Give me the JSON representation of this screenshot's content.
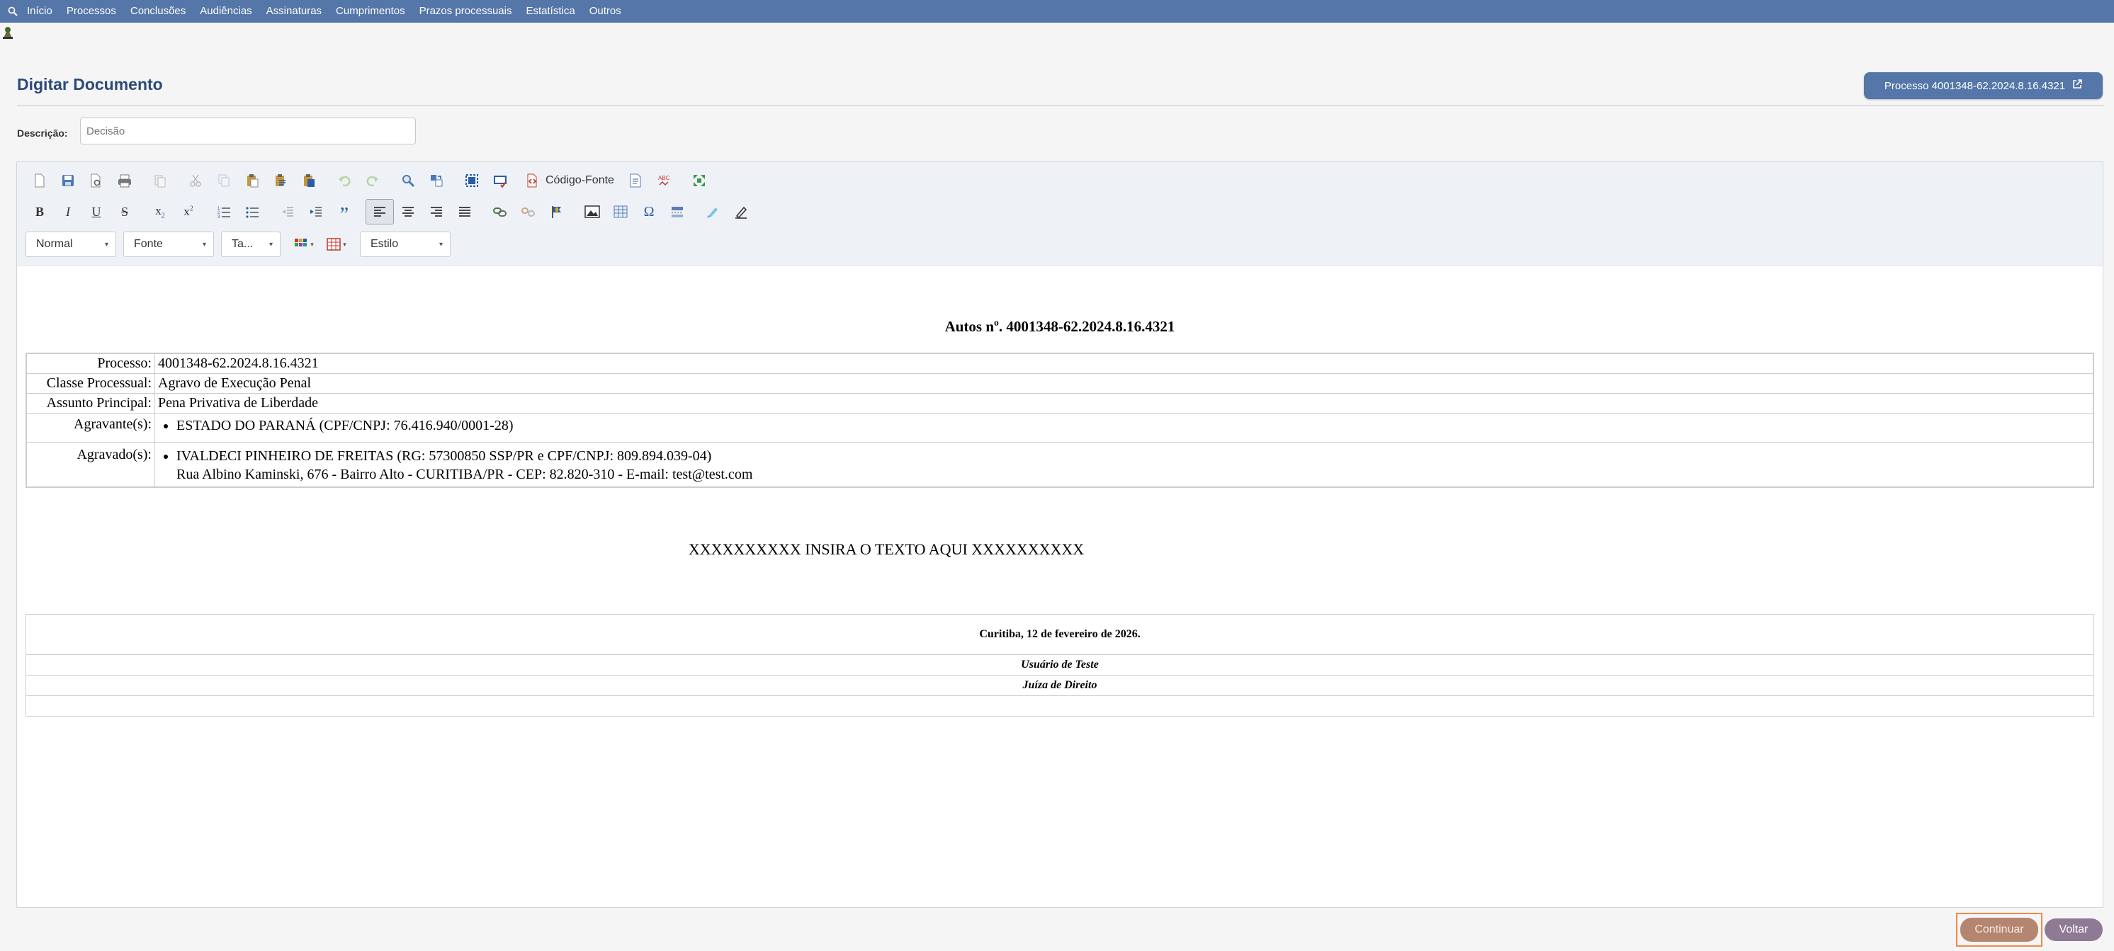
{
  "nav": {
    "items": [
      "Início",
      "Processos",
      "Conclusões",
      "Audiências",
      "Assinaturas",
      "Cumprimentos",
      "Prazos processuais",
      "Estatística",
      "Outros"
    ]
  },
  "page": {
    "title": "Digitar Documento",
    "process_button": "Processo 4001348-62.2024.8.16.4321"
  },
  "description": {
    "label": "Descrição:",
    "placeholder": "Decisão"
  },
  "toolbar": {
    "source_label": "Código-Fonte",
    "format_select": "Normal",
    "font_select": "Fonte",
    "size_select": "Ta...",
    "style_select": "Estilo"
  },
  "document": {
    "heading": "Autos nº. 4001348-62.2024.8.16.4321",
    "rows": [
      {
        "label": "Processo:",
        "value": "4001348-62.2024.8.16.4321"
      },
      {
        "label": "Classe Processual:",
        "value": "Agravo de Execução Penal"
      },
      {
        "label": "Assunto Principal:",
        "value": "Pena Privativa de Liberdade"
      }
    ],
    "agravante_label": "Agravante(s):",
    "agravante": "ESTADO DO PARANÁ (CPF/CNPJ: 76.416.940/0001-28)",
    "agravado_label": "Agravado(s):",
    "agravado": "IVALDECI PINHEIRO DE FREITAS (RG: 57300850 SSP/PR e CPF/CNPJ: 809.894.039-04)",
    "agravado_address": "Rua Albino Kaminski, 676 - Bairro Alto - CURITIBA/PR - CEP: 82.820-310 - E-mail: test@test.com",
    "placeholder_text": "XXXXXXXXXX INSIRA O TEXTO AQUI XXXXXXXXXX",
    "date_line": "Curitiba, 12 de fevereiro de 2026.",
    "signer": "Usuário de Teste",
    "role": "Juíza de Direito"
  },
  "footer": {
    "continue": "Continuar",
    "back": "Voltar"
  }
}
